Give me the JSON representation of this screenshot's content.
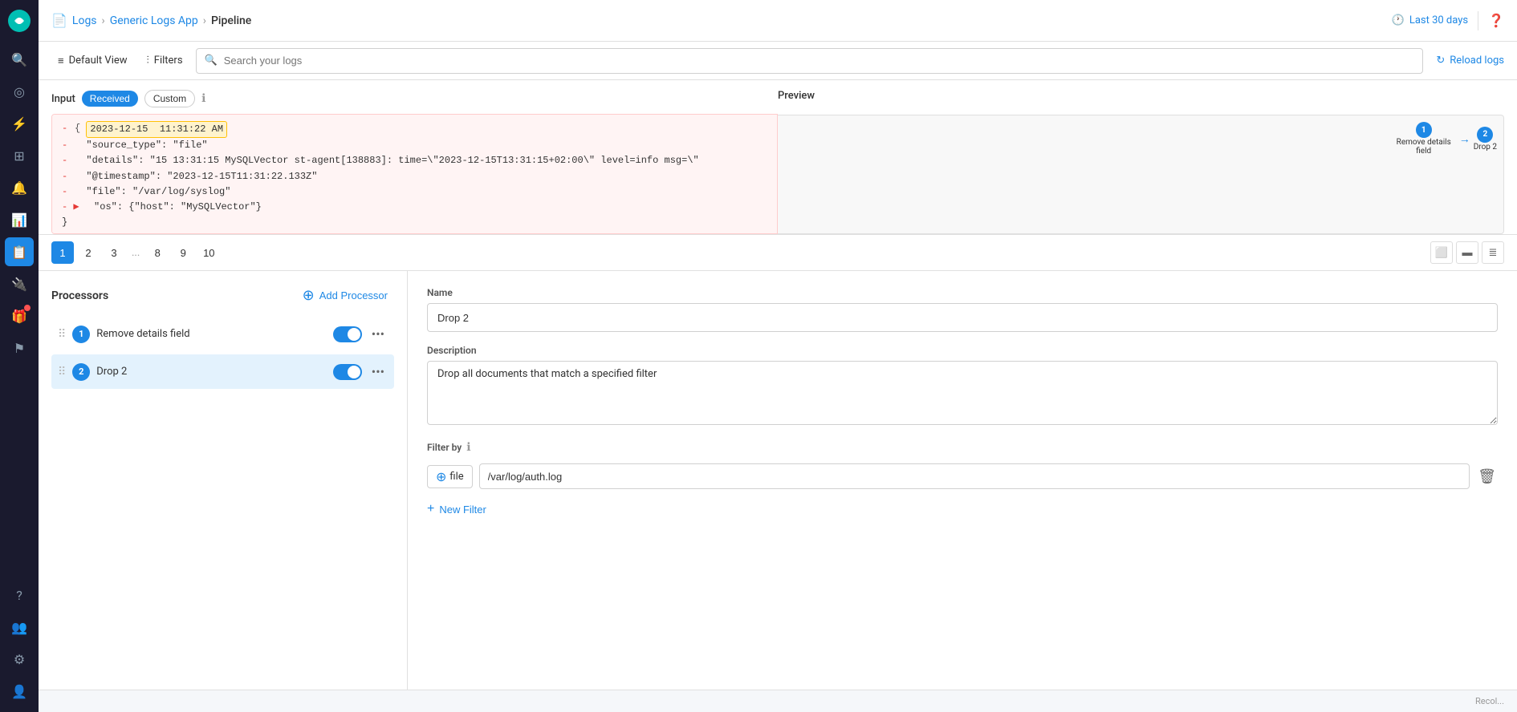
{
  "sidebar": {
    "logo_alt": "Elastic Logo",
    "items": [
      {
        "id": "search",
        "icon": "🔍",
        "label": "Search",
        "active": false
      },
      {
        "id": "observability",
        "icon": "◎",
        "label": "Observability",
        "active": false
      },
      {
        "id": "apm",
        "icon": "⚡",
        "label": "APM",
        "active": false
      },
      {
        "id": "grid",
        "icon": "⊞",
        "label": "Grid",
        "active": false
      },
      {
        "id": "alert",
        "icon": "🔔",
        "label": "Alert",
        "active": false
      },
      {
        "id": "dashboard",
        "icon": "📊",
        "label": "Dashboard",
        "active": false
      },
      {
        "id": "logs",
        "icon": "📋",
        "label": "Logs",
        "active": true
      },
      {
        "id": "integrations",
        "icon": "🔌",
        "label": "Integrations",
        "active": false
      },
      {
        "id": "flag",
        "icon": "⚑",
        "label": "Flag",
        "active": false
      },
      {
        "id": "help",
        "icon": "?",
        "label": "Help",
        "active": false
      },
      {
        "id": "team",
        "icon": "👥",
        "label": "Team",
        "active": false
      },
      {
        "id": "settings",
        "icon": "⚙",
        "label": "Settings",
        "active": false
      },
      {
        "id": "user",
        "icon": "👤",
        "label": "User",
        "active": false
      }
    ],
    "gift_item": {
      "icon": "🎁",
      "label": "Gift",
      "has_badge": true
    }
  },
  "topbar": {
    "breadcrumb_icon": "📄",
    "logs_link": "Logs",
    "app_link": "Generic Logs App",
    "current_page": "Pipeline",
    "time_range": "Last 30 days",
    "help_tooltip": "Help"
  },
  "secondbar": {
    "default_view_label": "Default View",
    "filters_label": "Filters",
    "search_placeholder": "Search your logs",
    "reload_label": "Reload logs"
  },
  "input_preview": {
    "input_label": "Input",
    "tab_received": "Received",
    "tab_custom": "Custom",
    "preview_label": "Preview",
    "step1_label": "Remove details field",
    "step2_label": "Drop 2",
    "code_lines": [
      {
        "prefix": "-",
        "content": "{ ",
        "highlight": "2023-12-15  11:31:22 AM"
      },
      {
        "prefix": "-",
        "content": "  \"source_type\": \"file\""
      },
      {
        "prefix": "-",
        "content": "  \"details\": \"15 13:31:15 MySQLVector st-agent[138883]: time=\\\"2023-12-15T13:31:15+02:00\\\" level=info msg=\\\""
      },
      {
        "prefix": "-",
        "content": "  \"@timestamp\": \"2023-12-15T11:31:22.133Z\""
      },
      {
        "prefix": "-",
        "content": "  \"file\": \"/var/log/syslog\""
      },
      {
        "prefix": "- ▶",
        "content": "  \"os\": {\"host\": \"MySQLVector\"}"
      },
      {
        "prefix": "",
        "content": "}"
      }
    ]
  },
  "pagination": {
    "pages": [
      "1",
      "2",
      "3",
      "...",
      "8",
      "9",
      "10"
    ],
    "active_page": "1"
  },
  "processors": {
    "title": "Processors",
    "add_button_label": "Add Processor",
    "items": [
      {
        "id": 1,
        "number": "1",
        "name": "Remove details field",
        "enabled": true,
        "selected": false
      },
      {
        "id": 2,
        "number": "2",
        "name": "Drop 2",
        "enabled": true,
        "selected": true
      }
    ]
  },
  "detail": {
    "name_label": "Name",
    "name_value": "Drop 2",
    "description_label": "Description",
    "description_value": "Drop all documents that match a specified filter",
    "filter_by_label": "Filter by",
    "filter_field_name": "file",
    "filter_field_value": "/var/log/auth.log",
    "new_filter_label": "New Filter"
  },
  "bottom_bar": {
    "hint": "Recol..."
  }
}
